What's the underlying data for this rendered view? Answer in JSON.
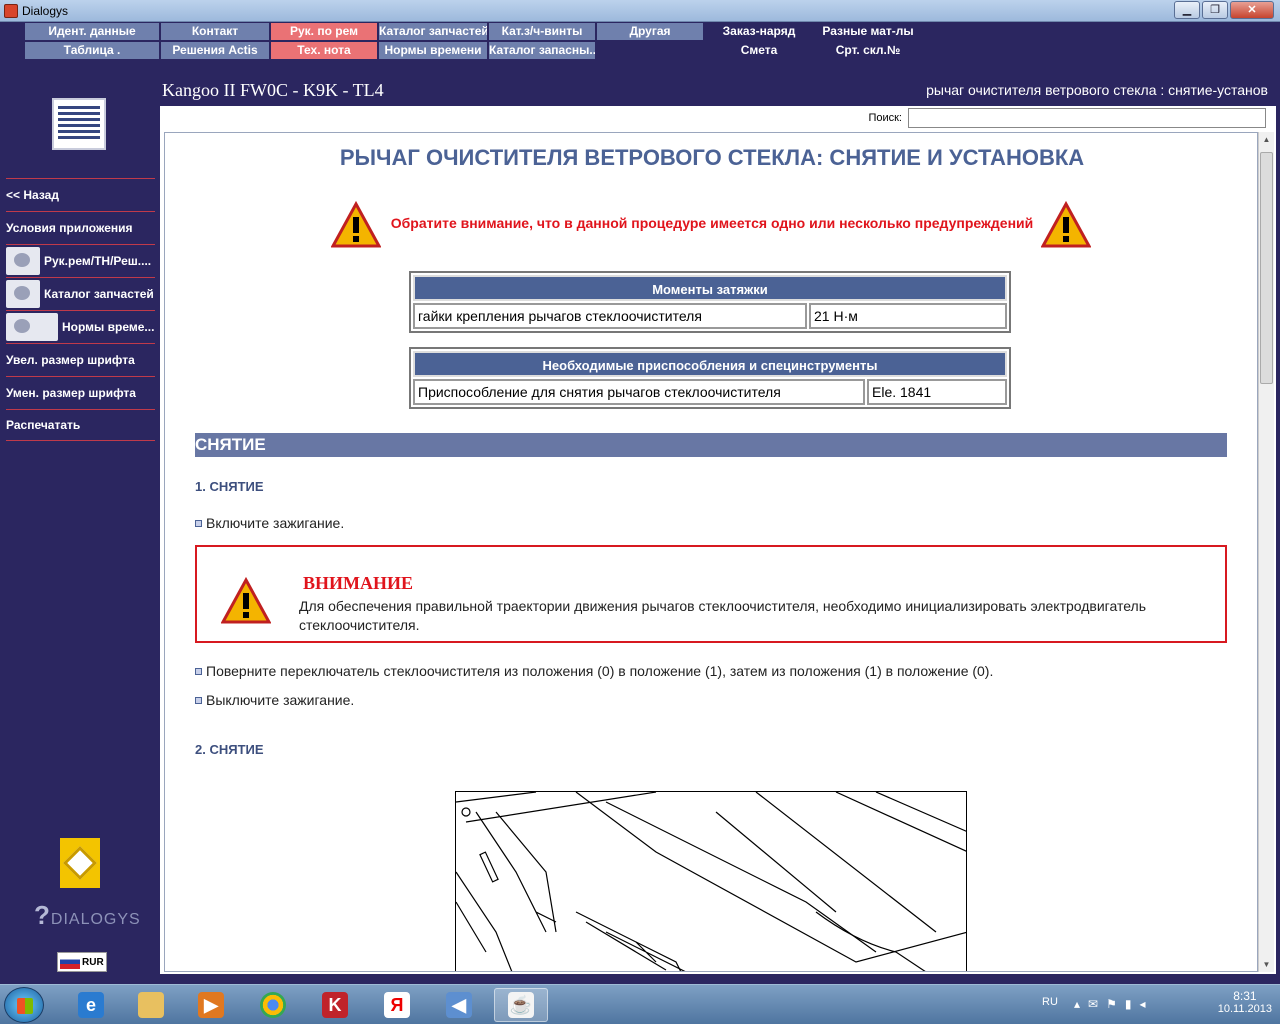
{
  "window": {
    "title": "Dialogys"
  },
  "menu": {
    "row1": [
      {
        "label": "Идент. данные",
        "style": "blue"
      },
      {
        "label": "Контакт",
        "style": "blue"
      },
      {
        "label": "Рук. по рем",
        "style": "red"
      },
      {
        "label": "Каталог запчастей",
        "style": "blue"
      },
      {
        "label": "Кат.з/ч-винты",
        "style": "blue"
      },
      {
        "label": "Другая",
        "style": "blue"
      },
      {
        "label": "Заказ-наряд",
        "style": "dark"
      },
      {
        "label": "Разные мат-лы",
        "style": "dark"
      }
    ],
    "row2": [
      {
        "label": "Таблица .",
        "style": "blue"
      },
      {
        "label": "Решения Actis",
        "style": "blue"
      },
      {
        "label": "Тех. нота",
        "style": "red"
      },
      {
        "label": "Нормы времени",
        "style": "blue"
      },
      {
        "label": "Каталог запасны...",
        "style": "blue"
      },
      {
        "label": "Смета",
        "style": "dark"
      },
      {
        "label": "Срт. скл.№",
        "style": "dark"
      }
    ]
  },
  "header": {
    "vehicle": "Kangoo II FW0C - K9K - TL4",
    "doc_title": "рычаг очистителя ветрового стекла : снятие-установ"
  },
  "sidebar": {
    "items": [
      {
        "label": "<< Назад"
      },
      {
        "label": "Условия приложения"
      },
      {
        "label": "Рук.рем/ТН/Реш...."
      },
      {
        "label": "Каталог запчастей"
      },
      {
        "label": "Нормы време..."
      },
      {
        "label": "Увел. размер шрифта"
      },
      {
        "label": "Умен. размер шрифта"
      },
      {
        "label": "Распечатать"
      }
    ],
    "brand": "DIALOGYS",
    "currency": "RUR"
  },
  "search": {
    "label": "Поиск:",
    "value": ""
  },
  "document": {
    "title": "РЫЧАГ ОЧИСТИТЕЛЯ ВЕТРОВОГО СТЕКЛА: СНЯТИЕ И УСТАНОВКА",
    "warning_notice": "Обратите внимание, что в данной процедуре имеется одно или несколько предупреждений",
    "torque_table": {
      "header": "Моменты затяжки",
      "rows": [
        [
          "гайки крепления рычагов стеклоочистителя",
          "21 Н·м"
        ]
      ]
    },
    "tools_table": {
      "header": "Необходимые приспособления и специнструменты",
      "rows": [
        [
          "Приспособление для снятия рычагов стеклоочистителя",
          "Ele. 1841"
        ]
      ]
    },
    "section": "СНЯТИЕ",
    "step1_title": "1. СНЯТИЕ",
    "step1_bullet": "Включите зажигание.",
    "attention": {
      "title": "ВНИМАНИЕ",
      "text": "Для обеспечения правильной траектории движения рычагов стеклоочистителя, необходимо инициализировать электродвигатель стеклоочистителя."
    },
    "bullet2": "Поверните переключатель стеклоочистителя из положения (0) в положение (1), затем из положения (1) в положение (0).",
    "bullet3": "Выключите зажигание.",
    "step2_title": "2. СНЯТИЕ"
  },
  "taskbar": {
    "lang": "RU",
    "time": "8:31",
    "date": "10.11.2013"
  }
}
